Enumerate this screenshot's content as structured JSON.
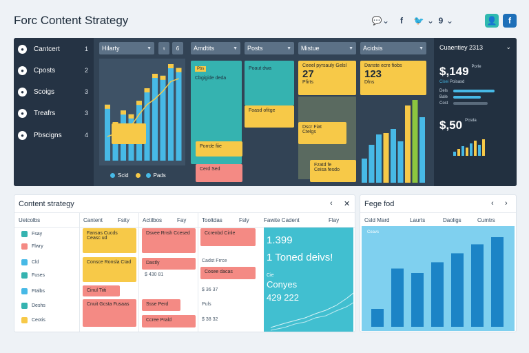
{
  "app": {
    "title": "Forc Content Strategy"
  },
  "header": {
    "social": [
      {
        "name": "chat-icon",
        "glyph": "💬"
      },
      {
        "name": "chevron-icon",
        "glyph": "⌄"
      },
      {
        "name": "facebook-icon",
        "glyph": "f"
      },
      {
        "name": "twitter-icon",
        "glyph": "🐦"
      },
      {
        "name": "chevron-icon-2",
        "glyph": "⌄"
      },
      {
        "name": "pinterest-icon",
        "glyph": "9"
      },
      {
        "name": "chevron-icon-3",
        "glyph": "⌄"
      }
    ],
    "user_btn": "👤",
    "fb_btn": "f"
  },
  "nav": {
    "items": [
      {
        "label": "Cantcert",
        "num": "1"
      },
      {
        "label": "Cposts",
        "num": "2"
      },
      {
        "label": "Scoigs",
        "num": "3"
      },
      {
        "label": "Treafrs",
        "num": "3"
      },
      {
        "label": "Pbscigns",
        "num": "4"
      }
    ]
  },
  "toolbar": {
    "d1": "Hilarty",
    "d2": "Amdtits",
    "d3": "Posts",
    "d4": "Mistue",
    "d5": "Acidsis",
    "s1": "♀",
    "s2": "6"
  },
  "chart1": {
    "legend_a": "Scid",
    "legend_b": "Pads",
    "values": [
      58,
      40,
      52,
      48,
      62,
      75,
      90,
      88,
      100,
      96
    ],
    "line": [
      25,
      28,
      30,
      36,
      48,
      58,
      64,
      72,
      82,
      85
    ],
    "card": "",
    "tick": ""
  },
  "cards": {
    "teal_tag": "Pbs",
    "teal_text": "Cbgigide deda",
    "teal2_text": "Poaut dwa",
    "y1_text": "Foasd ofitge",
    "y_small1": "Porrde fiie",
    "r_small1": "Cerd Sed",
    "y2_title": "Ceeel pyrsauly Gelsl",
    "y2_big": "27",
    "y2_sub": "Pfirts",
    "y3_title": "Danste ecre fiobs",
    "y3_big": "123",
    "y3_sub": "Dfns",
    "y4_text": "Dscr Fiat",
    "y4_sub": "Ctelgs",
    "y5_text": "Fzatd fe",
    "y5_sub": "Ceisa fesdo"
  },
  "side": {
    "header": "Cuaentiey 2313",
    "big1": "$,149",
    "small1": "Porle",
    "label1": "Cisei",
    "small2": "Poisasd",
    "rows": [
      "Dels",
      "Bale",
      "Cost"
    ],
    "big2": "$,50",
    "small3": "Pcsda"
  },
  "panelA": {
    "title": "Content strategy",
    "cols": [
      "Uetcolbs",
      "Cantent",
      "Fsity",
      "Actilbos",
      "Fay",
      "Tooltdas",
      "Fsly",
      "Fawite Cadent",
      "Flay"
    ],
    "rows": [
      "Fsay",
      "Flwry",
      "Cld",
      "Fuses",
      "Ftalbs",
      "Deshs",
      "Ceotis"
    ],
    "cells": {
      "c1": "Fansas Cucds Ceasc ud",
      "c2": "Consce Ronsla Ctad",
      "c3": "Cinul Tiiti",
      "c4": "Cnuit Gcsta Fusaas",
      "c5": "Dsvee Rnsh Ccesed",
      "c6": "Dastly",
      "c7": "$ 430 81",
      "c8": "Ssse Perd",
      "c9": "Ccree Prald",
      "c10": "Ccrenbd Cinle",
      "c11": "Cadst Frrce",
      "c12": "Cosee dacas",
      "c13": "Puls",
      "c14": "$ 36 37",
      "c15": "$ 38 32"
    },
    "teal": {
      "n1": "1.399",
      "t1": "1 Toned deivs!",
      "lab": "Cie",
      "t2": "Conyes",
      "n2": "429 222"
    }
  },
  "panelB": {
    "title": "Fege fod",
    "cols": [
      "Csld Mard",
      "Laurts",
      "Daoligs",
      "Cumtrs"
    ],
    "chart_data": {
      "type": "bar",
      "legend": "Ceavs",
      "values": [
        20,
        65,
        60,
        72,
        82,
        92,
        100
      ]
    }
  }
}
